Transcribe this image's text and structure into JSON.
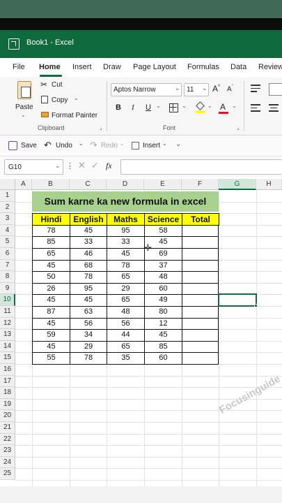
{
  "app": {
    "title": "Book1  -  Excel"
  },
  "tabs": [
    "File",
    "Home",
    "Insert",
    "Draw",
    "Page Layout",
    "Formulas",
    "Data",
    "Review"
  ],
  "active_tab": "Home",
  "clipboard": {
    "paste": "Paste",
    "cut": "Cut",
    "copy": "Copy",
    "format_painter": "Format Painter",
    "group_label": "Clipboard"
  },
  "font": {
    "name": "Aptos Narrow",
    "size": "11",
    "group_label": "Font",
    "bold": "B",
    "italic": "I",
    "underline": "U",
    "grow": "A",
    "shrink": "A",
    "font_color_letter": "A"
  },
  "qat": {
    "save": "Save",
    "undo": "Undo",
    "redo": "Redo",
    "insert": "Insert"
  },
  "formula_bar": {
    "name_box": "G10",
    "fx": "fx",
    "value": ""
  },
  "columns": [
    "A",
    "B",
    "C",
    "D",
    "E",
    "F",
    "G",
    "H"
  ],
  "selected_column": "G",
  "selected_row": 10,
  "rows": [
    1,
    2,
    3,
    4,
    5,
    6,
    7,
    8,
    9,
    10,
    11,
    12,
    13,
    14,
    15,
    16,
    17,
    18,
    19,
    20,
    21,
    22,
    23,
    24,
    25
  ],
  "sheet": {
    "title": "Sum karne ka new formula in excel",
    "headers": [
      "Hindi",
      "English",
      "Maths",
      "Science",
      "Total"
    ],
    "data": [
      [
        78,
        45,
        95,
        58
      ],
      [
        85,
        33,
        33,
        45
      ],
      [
        65,
        46,
        45,
        69
      ],
      [
        45,
        68,
        78,
        37
      ],
      [
        50,
        78,
        65,
        48
      ],
      [
        26,
        95,
        29,
        60
      ],
      [
        45,
        45,
        65,
        49
      ],
      [
        87,
        63,
        48,
        80
      ],
      [
        45,
        56,
        56,
        12
      ],
      [
        59,
        34,
        44,
        45
      ],
      [
        45,
        29,
        65,
        85
      ],
      [
        55,
        78,
        35,
        60
      ]
    ]
  },
  "watermark": "Focusinguide",
  "colors": {
    "excel_green": "#0f6b3e",
    "title_fill": "#a9d18e",
    "header_fill": "#ffff00"
  }
}
